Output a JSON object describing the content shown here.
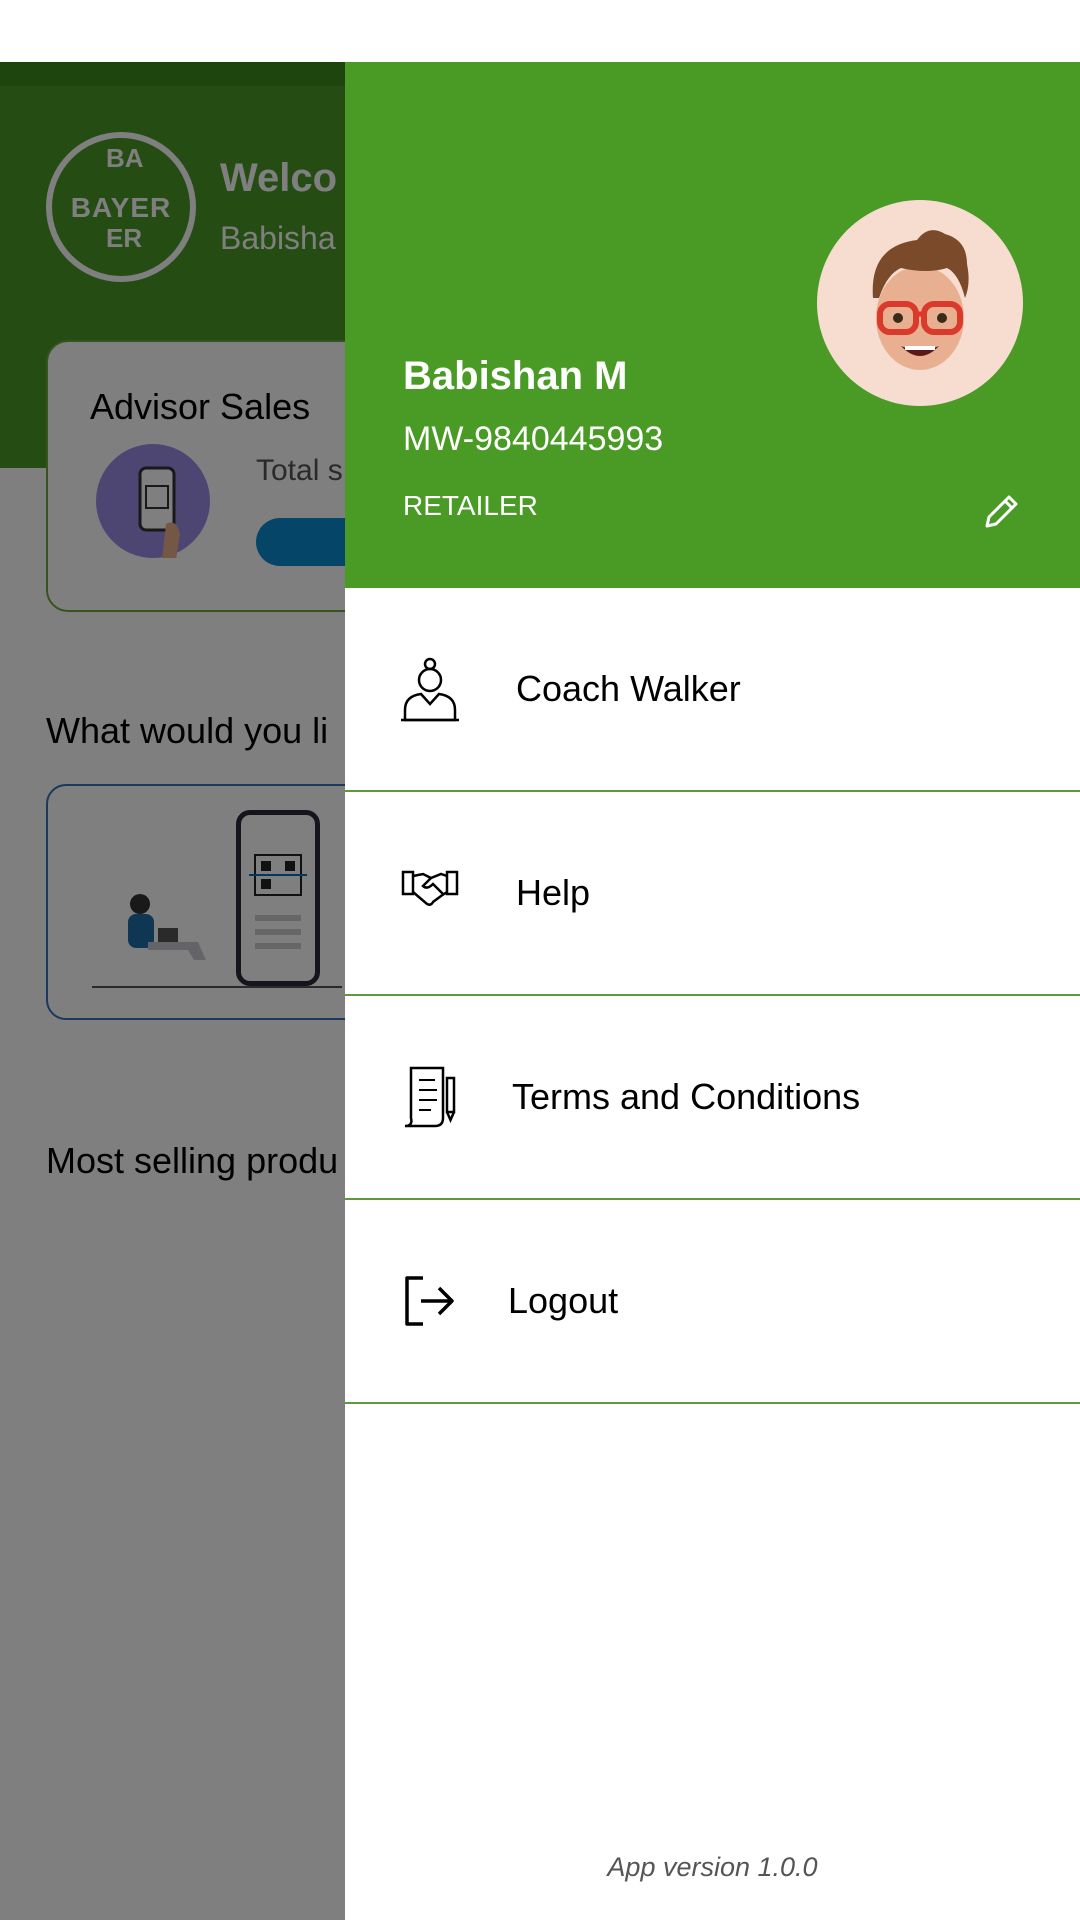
{
  "background": {
    "logo_letters": {
      "top": "BA",
      "middle": "BAYER",
      "bottom": "ER"
    },
    "welcome": "Welco",
    "subtitle": "Babisha",
    "card_title": "Advisor Sales",
    "total_label": "Total s",
    "question": "What would you li",
    "most_selling": "Most selling produ"
  },
  "profile": {
    "name": "Babishan M",
    "id": "MW-9840445993",
    "role": "RETAILER"
  },
  "menu": [
    {
      "label": "Coach Walker",
      "icon": "coach-icon"
    },
    {
      "label": "Help",
      "icon": "handshake-icon"
    },
    {
      "label": "Terms and Conditions",
      "icon": "document-icon"
    },
    {
      "label": "Logout",
      "icon": "logout-icon"
    }
  ],
  "app_version": "App version 1.0.0",
  "colors": {
    "primary_green": "#4a9a26",
    "divider": "#5e9a3a"
  }
}
